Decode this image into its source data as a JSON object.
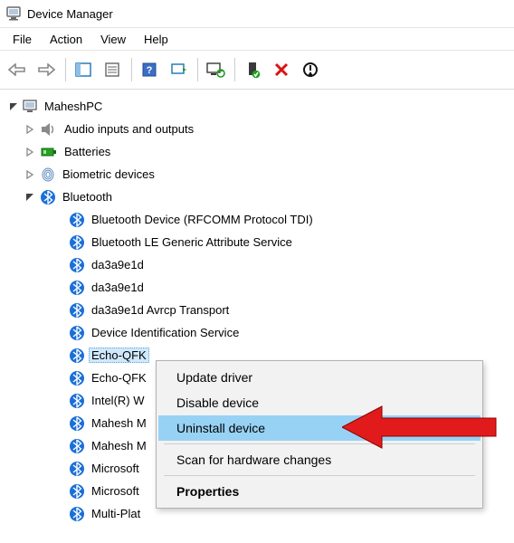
{
  "window": {
    "title": "Device Manager"
  },
  "menu": {
    "file": "File",
    "action": "Action",
    "view": "View",
    "help": "Help"
  },
  "tree": {
    "root": "MaheshPC",
    "cat_audio": "Audio inputs and outputs",
    "cat_batteries": "Batteries",
    "cat_biometric": "Biometric devices",
    "cat_bluetooth": "Bluetooth",
    "bt0": "Bluetooth Device (RFCOMM Protocol TDI)",
    "bt1": "Bluetooth LE Generic Attribute Service",
    "bt2": "da3a9e1d",
    "bt3": "da3a9e1d",
    "bt4": "da3a9e1d Avrcp Transport",
    "bt5": "Device Identification Service",
    "bt6": "Echo-QFK",
    "bt7": "Echo-QFK",
    "bt8": "Intel(R) W",
    "bt9": "Mahesh M",
    "bt10": "Mahesh M",
    "bt11": "Microsoft",
    "bt12": "Microsoft",
    "bt13": "Multi-Plat"
  },
  "context_menu": {
    "update": "Update driver",
    "disable": "Disable device",
    "uninstall": "Uninstall device",
    "scan": "Scan for hardware changes",
    "properties": "Properties"
  }
}
